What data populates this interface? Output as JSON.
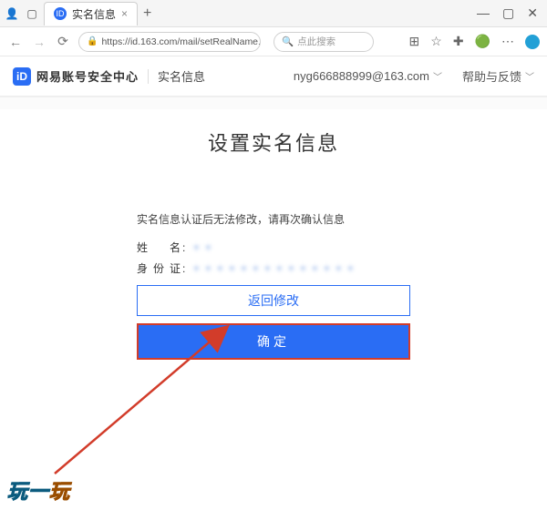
{
  "browser": {
    "tab_title": "实名信息",
    "new_tab_glyph": "+",
    "close_glyph": "×",
    "minimize_glyph": "—",
    "square_glyph": "▢",
    "xglyph": "✕",
    "url": "https://id.163.com/mail/setRealName.ht…",
    "lock_glyph": "🔒",
    "search_placeholder": "点此搜索",
    "search_glyph": "🔍"
  },
  "site_header": {
    "logo_text": "iD",
    "brand": "网易账号安全中心",
    "crumb": "实名信息",
    "account": "nyg666888999@163.com",
    "help": "帮助与反馈"
  },
  "page": {
    "title": "设置实名信息",
    "notice": "实名信息认证后无法修改，请再次确认信息",
    "name_label": "姓　名",
    "name_value": "＊＊",
    "id_label": "身份证",
    "id_value": "＊＊＊＊＊＊＊＊＊＊＊＊＊＊",
    "btn_back": "返回修改",
    "btn_confirm": "确定"
  },
  "watermark": {
    "part1": "玩一",
    "part2": "玩"
  },
  "colors": {
    "primary": "#2a6df4",
    "highlight_border": "#d23c2a"
  }
}
